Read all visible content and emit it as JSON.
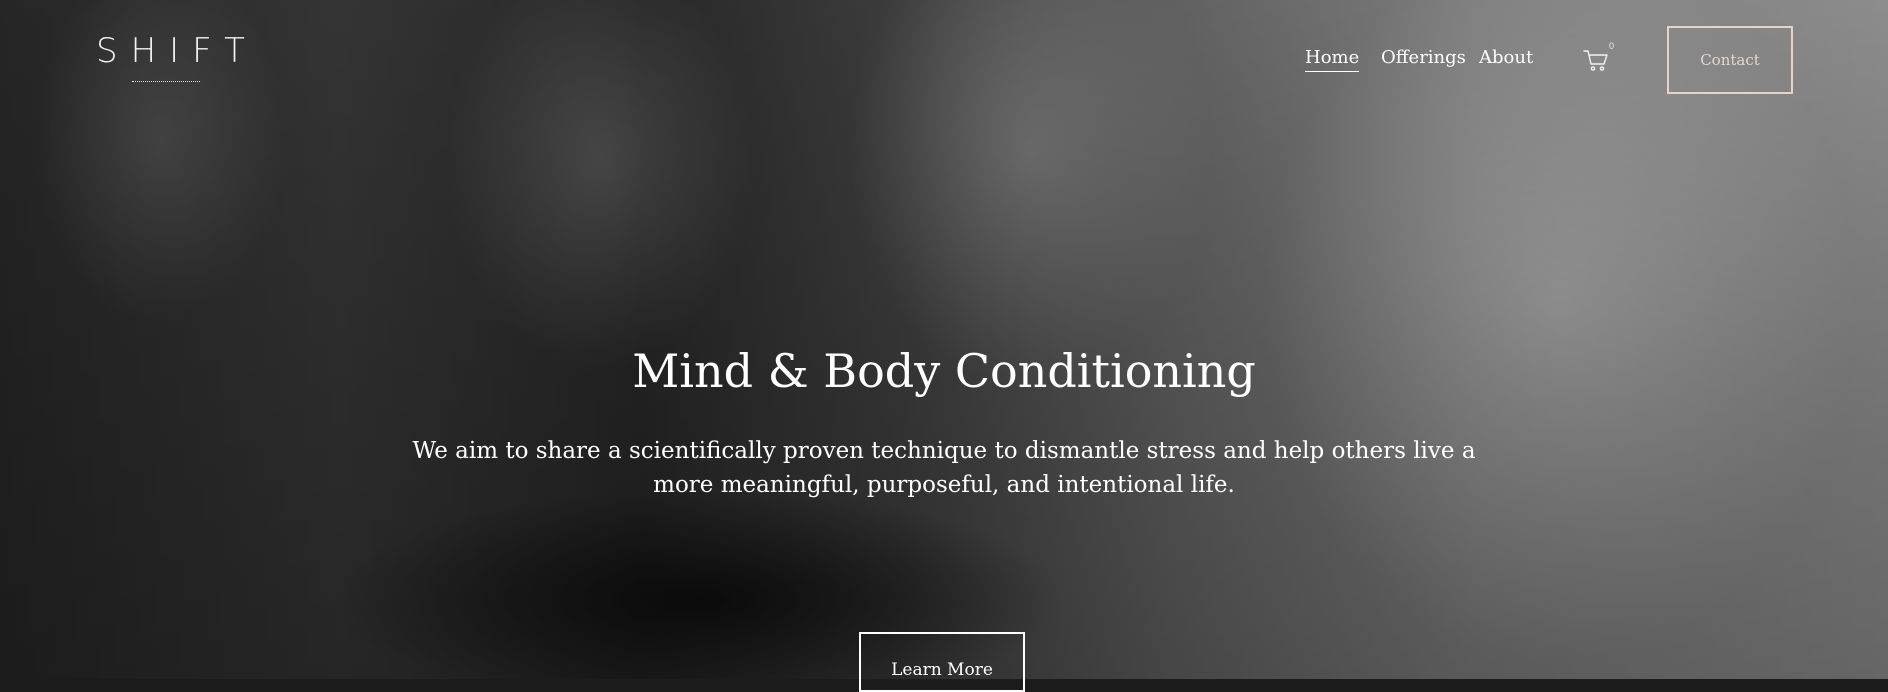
{
  "header": {
    "logo_text": "SHIFT",
    "nav": [
      {
        "label": "Home",
        "active": true
      },
      {
        "label": "Offerings",
        "active": false
      },
      {
        "label": "About",
        "active": false
      }
    ],
    "cart": {
      "icon": "shopping-cart-icon",
      "count": "0"
    },
    "contact_label": "Contact"
  },
  "hero": {
    "title": "Mind & Body Conditioning",
    "description": "We aim to share a scientifically proven technique to dismantle stress and help others live a more meaningful, purposeful, and intentional life.",
    "cta_label": "Learn More",
    "background": "black-and-white-yoga-class-meditation-photo"
  },
  "colors": {
    "text": "#ffffff",
    "contact_border": "#e9d3c6",
    "contact_text": "#e6d6cc"
  }
}
